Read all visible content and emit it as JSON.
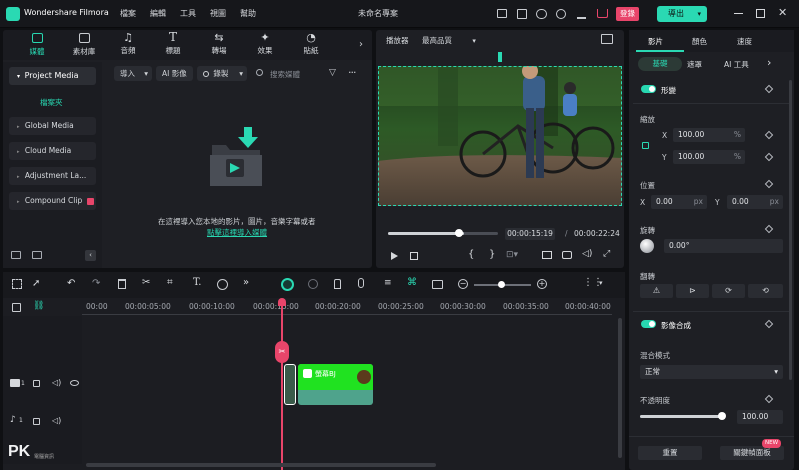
{
  "app": {
    "name": "Wondershare Filmora",
    "project": "未命名專案",
    "menu": [
      "檔案",
      "編輯",
      "工具",
      "視圖",
      "幫助"
    ],
    "login": "登錄",
    "export": "導出"
  },
  "media_tabs": [
    {
      "label": "媒體"
    },
    {
      "label": "素材庫"
    },
    {
      "label": "音頻"
    },
    {
      "label": "標題"
    },
    {
      "label": "轉場"
    },
    {
      "label": "效果"
    },
    {
      "label": "貼紙"
    }
  ],
  "sidebar": {
    "project_media": "Project Media",
    "folder": "檔案夾",
    "items": [
      "Global Media",
      "Cloud Media",
      "Adjustment La...",
      "Compound Clip"
    ]
  },
  "media_toolbar": {
    "import": "導入",
    "ai_image": "AI 影像",
    "record": "錄製",
    "search_placeholder": "搜索媒體"
  },
  "media_empty": {
    "hint": "在這裡導入您本地的影片，圖片，音樂字幕或者",
    "link": "點擊這裡導入媒體"
  },
  "player": {
    "label": "播放器",
    "quality": "最高品質",
    "current_time": "00:00:15:19",
    "total_time": "00:00:22:24",
    "separator": "/",
    "progress": 0.69
  },
  "props": {
    "tabs": [
      "影片",
      "顏色",
      "速度"
    ],
    "subtabs": [
      "基礎",
      "遮罩",
      "AI 工具"
    ],
    "transform": "形變",
    "scale": "縮放",
    "x_label": "X",
    "y_label": "Y",
    "scale_x": "100.00",
    "scale_y": "100.00",
    "percent": "%",
    "position": "位置",
    "pos_x": "0.00",
    "pos_y": "0.00",
    "px": "px",
    "rotate": "旋轉",
    "rotation": "0.00°",
    "flip": "翻轉",
    "compositing": "影像合成",
    "blend_mode_label": "混合模式",
    "blend_mode": "正常",
    "opacity_label": "不透明度",
    "opacity": "100.00",
    "opacity_level": 1.0,
    "reset": "重置",
    "keyframe_panel": "關鍵幀面板",
    "new_badge": "NEW"
  },
  "timeline": {
    "ticks": [
      "00:00",
      "00:00:05:00",
      "00:00:10:00",
      "00:00:15:00",
      "00:00:20:00",
      "00:00:25:00",
      "00:00:30:00",
      "00:00:35:00",
      "00:00:40:00"
    ],
    "clip_label": "螢幕BJ",
    "video_track": "1",
    "audio_track": "1"
  },
  "watermark": {
    "logo": "PK",
    "sub": "電腦資訊"
  }
}
